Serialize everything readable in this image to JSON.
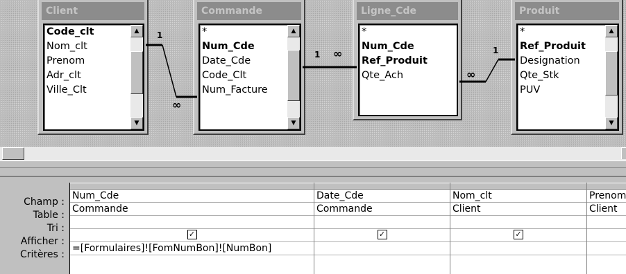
{
  "tables": [
    {
      "title": "Client",
      "fields": [
        {
          "name": "Code_clt",
          "pk": true
        },
        {
          "name": "Nom_clt",
          "pk": false
        },
        {
          "name": "Prenom",
          "pk": false
        },
        {
          "name": "Adr_clt",
          "pk": false
        },
        {
          "name": "Ville_Clt",
          "pk": false
        }
      ]
    },
    {
      "title": "Commande",
      "fields": [
        {
          "name": "*",
          "pk": false
        },
        {
          "name": "Num_Cde",
          "pk": true
        },
        {
          "name": "Date_Cde",
          "pk": false
        },
        {
          "name": "Code_Clt",
          "pk": false
        },
        {
          "name": "Num_Facture",
          "pk": false
        }
      ]
    },
    {
      "title": "Ligne_Cde",
      "fields": [
        {
          "name": "*",
          "pk": false
        },
        {
          "name": "Num_Cde",
          "pk": true
        },
        {
          "name": "Ref_Produit",
          "pk": true
        },
        {
          "name": "Qte_Ach",
          "pk": false
        }
      ]
    },
    {
      "title": "Produit",
      "fields": [
        {
          "name": "*",
          "pk": false
        },
        {
          "name": "Ref_Produit",
          "pk": true
        },
        {
          "name": "Designation",
          "pk": false
        },
        {
          "name": "Qte_Stk",
          "pk": false
        },
        {
          "name": "PUV",
          "pk": false
        }
      ]
    }
  ],
  "relations": [
    {
      "one": "1",
      "many": "∞"
    },
    {
      "one": "1",
      "many": "∞"
    },
    {
      "one": "1",
      "many": "∞"
    }
  ],
  "grid": {
    "row_labels": {
      "champ": "Champ :",
      "table": "Table :",
      "tri": "Tri :",
      "afficher": "Afficher :",
      "criteres": "Critères :"
    },
    "columns": [
      {
        "champ": "Num_Cde",
        "table": "Commande",
        "tri": "",
        "afficher": true,
        "criteres": "=[Formulaires]![FomNumBon]![NumBon]"
      },
      {
        "champ": "Date_Cde",
        "table": "Commande",
        "tri": "",
        "afficher": true,
        "criteres": ""
      },
      {
        "champ": "Nom_clt",
        "table": "Client",
        "tri": "",
        "afficher": true,
        "criteres": ""
      },
      {
        "champ": "Prenom",
        "table": "Client",
        "tri": "",
        "afficher": true,
        "criteres": ""
      }
    ]
  },
  "icons": {
    "scroll_up": "scroll-up-arrow",
    "scroll_down": "scroll-down-arrow",
    "checkbox": "check-mark"
  }
}
